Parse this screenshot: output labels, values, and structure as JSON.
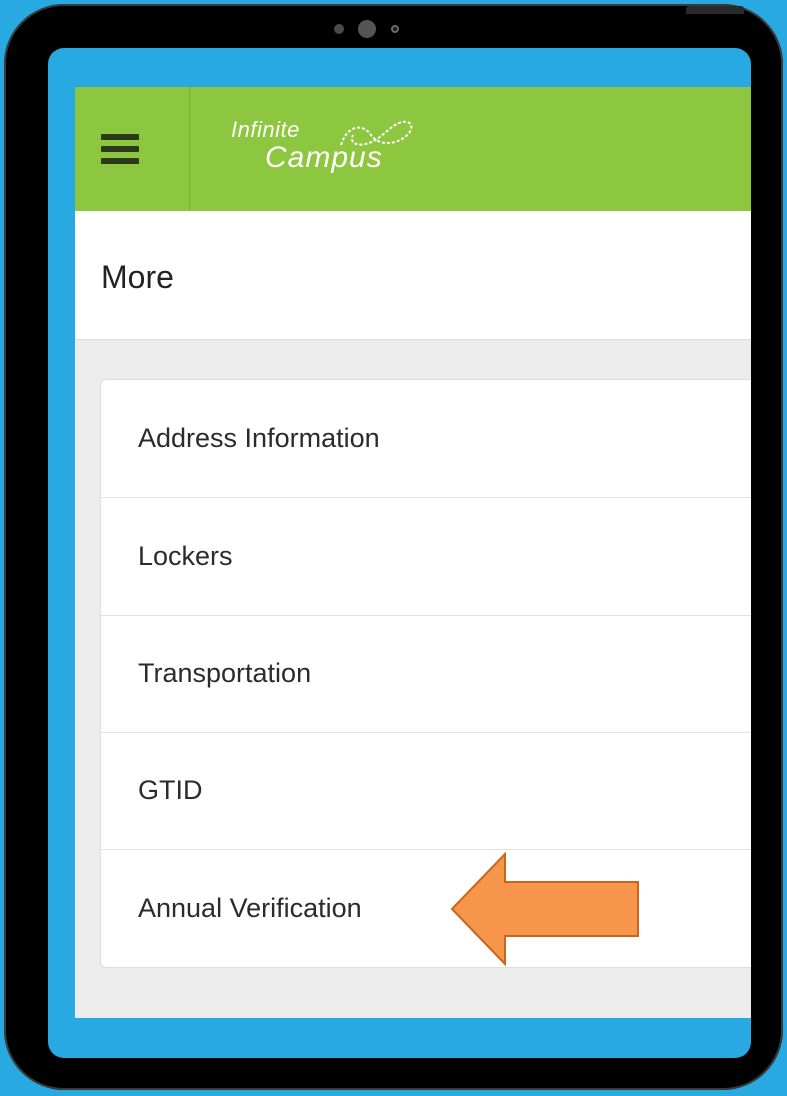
{
  "header": {
    "logo": {
      "line1": "Infinite",
      "line2": "Campus"
    },
    "menu_icon": "hamburger-menu-icon"
  },
  "page": {
    "title": "More"
  },
  "menu_list": {
    "items": [
      {
        "label": "Address Information"
      },
      {
        "label": "Lockers"
      },
      {
        "label": "Transportation"
      },
      {
        "label": "GTID"
      },
      {
        "label": "Annual Verification"
      }
    ]
  },
  "annotation": {
    "arrow_icon": "left-arrow-icon",
    "arrow_color": "#f5964a"
  },
  "colors": {
    "header_green": "#8dc63f",
    "background_blue": "#29a9e1",
    "device_frame": "#000000"
  }
}
